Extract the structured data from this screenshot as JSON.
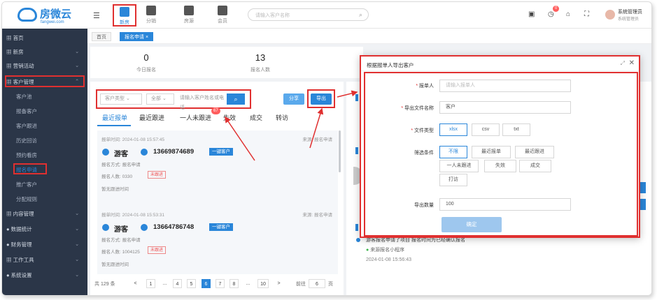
{
  "app": {
    "logo_text": "房微云",
    "logo_sub": "fangwei.com"
  },
  "topnav": [
    {
      "label": "新房",
      "icon": "building-icon"
    },
    {
      "label": "分销",
      "icon": "org-chart-icon"
    },
    {
      "label": "房源",
      "icon": "house-icon"
    },
    {
      "label": "会员",
      "icon": "member-icon"
    }
  ],
  "search": {
    "placeholder": "请输入客户名称",
    "icon": "⌕"
  },
  "header": {
    "notification_count": "0",
    "user_name": "系统管理员",
    "user_role": "系统管理员"
  },
  "sidebar": {
    "items": [
      {
        "label": "首页"
      },
      {
        "label": "新房"
      },
      {
        "label": "营销活动"
      },
      {
        "label": "客户管理"
      },
      {
        "label": "客户池"
      },
      {
        "label": "报备客户"
      },
      {
        "label": "客户跟进"
      },
      {
        "label": "历史回访"
      },
      {
        "label": "预约看房"
      },
      {
        "label": "报名申请"
      },
      {
        "label": "推广客户"
      },
      {
        "label": "分配规则"
      },
      {
        "label": "内容管理"
      },
      {
        "label": "数据统计"
      },
      {
        "label": "财务管理"
      },
      {
        "label": "工作工具"
      },
      {
        "label": "系统设置"
      }
    ]
  },
  "breadcrumb": [
    "首页",
    "报名申请 ×"
  ],
  "stats": [
    {
      "num": "0",
      "label": "今日报名"
    },
    {
      "num": "13",
      "label": "报名人数"
    }
  ],
  "filters": {
    "sel1": "客户类型",
    "sel2": "全部",
    "search_placeholder": "请输入客户姓名或电话",
    "search_icon": "⌕",
    "share_btn": "分享",
    "export_btn": "导出"
  },
  "tabs": [
    "最近报单",
    "最近跟进",
    "一人未跟进",
    "失效",
    "成交",
    "转访"
  ],
  "tab_badge": "67",
  "cards": [
    {
      "time": "报单时间: 2024-01-08 15:57:45",
      "source": "来源: 报名申请",
      "name": "游客",
      "phone": "13669874689",
      "tag": "一键客户",
      "line1": "报名方式: 报名申请",
      "line2": "报名人数: 0330",
      "status": "未跟进",
      "line3": "暂无跟进时间"
    },
    {
      "time": "报单时间: 2024-01-08 15:53:31",
      "source": "来源: 报名申请",
      "name": "游客",
      "phone": "13664786748",
      "tag": "一键客户",
      "line1": "报名方式: 报名申请",
      "line2": "报名人数: 1004125",
      "status": "未跟进",
      "line3": "暂无跟进时间"
    }
  ],
  "pager": {
    "total": "共 129 条",
    "pages": [
      "1",
      "...",
      "4",
      "5",
      "6",
      "7",
      "8",
      "...",
      "10"
    ],
    "prev": "<",
    "next": ">",
    "goto_label": "前往",
    "goto_value": "6",
    "goto_unit": "页"
  },
  "right_panel": {
    "footer_text": "游客报名申请了项目  报名时间为已经确认报名",
    "footer_sub": "来源报名小程序",
    "footer_time": "2024-01-08 15:56:43"
  },
  "modal": {
    "title": "根据报单人导出客户",
    "expand_icon": "⤢",
    "close_icon": "✕",
    "fields": [
      {
        "label": "报单人",
        "placeholder": "请输入报单人"
      },
      {
        "label": "导出文件名称",
        "value": "客户"
      }
    ],
    "format_label": "文件类型",
    "formats": [
      "xlsx",
      "csv",
      "txt"
    ],
    "scope_label": "筛选条件",
    "scopes": [
      "不限",
      "最近报单",
      "最近跟进",
      "一人未跟进",
      "失效",
      "成交",
      "打访"
    ],
    "count_label": "导出数量",
    "count_value": "100",
    "submit": "确定"
  }
}
